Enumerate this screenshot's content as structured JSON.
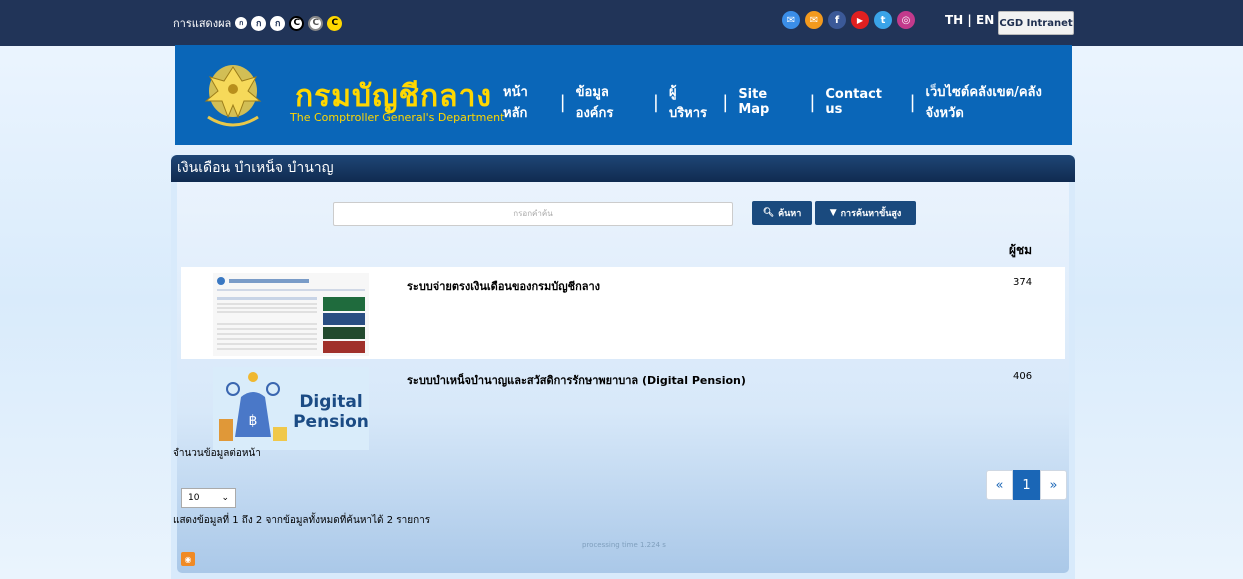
{
  "topbar": {
    "display_label": "การแสดงผล",
    "font_controls": [
      "ก",
      "ก",
      "ก",
      "C",
      "C",
      "C"
    ],
    "social": [
      {
        "name": "email-icon",
        "glyph": "✉",
        "color": "#3b8ee8"
      },
      {
        "name": "mail-icon",
        "glyph": "✉",
        "color": "#f39a1e"
      },
      {
        "name": "facebook-icon",
        "glyph": "f",
        "color": "#3b5998"
      },
      {
        "name": "youtube-icon",
        "glyph": "▶",
        "color": "#e02020"
      },
      {
        "name": "twitter-icon",
        "glyph": "t",
        "color": "#3aa3e8"
      },
      {
        "name": "instagram-icon",
        "glyph": "◎",
        "color": "#c23a8c"
      }
    ],
    "lang_th": "TH",
    "lang_sep": "|",
    "lang_en": "EN",
    "intranet_label": "CGD Intranet"
  },
  "header": {
    "brand_th": "กรมบัญชีกลาง",
    "brand_en": "The Comptroller General's Department",
    "nav": [
      "หน้าหลัก",
      "ข้อมูลองค์กร",
      "ผู้บริหาร",
      "Site Map",
      "Contact us",
      "เว็บไซต์คลังเขต/คลังจังหวัด"
    ]
  },
  "panel": {
    "title": "เงินเดือน บำเหน็จ บำนาญ",
    "search_placeholder": "กรอกคำค้น",
    "search_button": "ค้นหา",
    "advanced_button": "การค้นหาขั้นสูง",
    "views_header": "ผู้ชม",
    "rows": [
      {
        "title": "ระบบจ่ายตรงเงินเดือนของกรมบัญชีกลาง",
        "views": "374"
      },
      {
        "title": "ระบบบำเหน็จบำนาญและสวัสดิการรักษาพยาบาล (Digital Pension)",
        "views": "406"
      }
    ],
    "per_page_label": "จำนวนข้อมูลต่อหน้า",
    "per_page_value": "10",
    "result_info": "แสดงข้อมูลที่ 1 ถึง 2 จากข้อมูลทั้งหมดที่ค้นหาได้ 2 รายการ",
    "processing_time": "processing time 1.224 s",
    "pager": {
      "prev": "«",
      "current": "1",
      "next": "»"
    },
    "thumb2_text": [
      "Digital",
      "Pension"
    ]
  },
  "colors": {
    "topbar": "#213458",
    "header": "#0a66b8",
    "brand": "#ffd700",
    "panel_title": "#1e4676"
  }
}
